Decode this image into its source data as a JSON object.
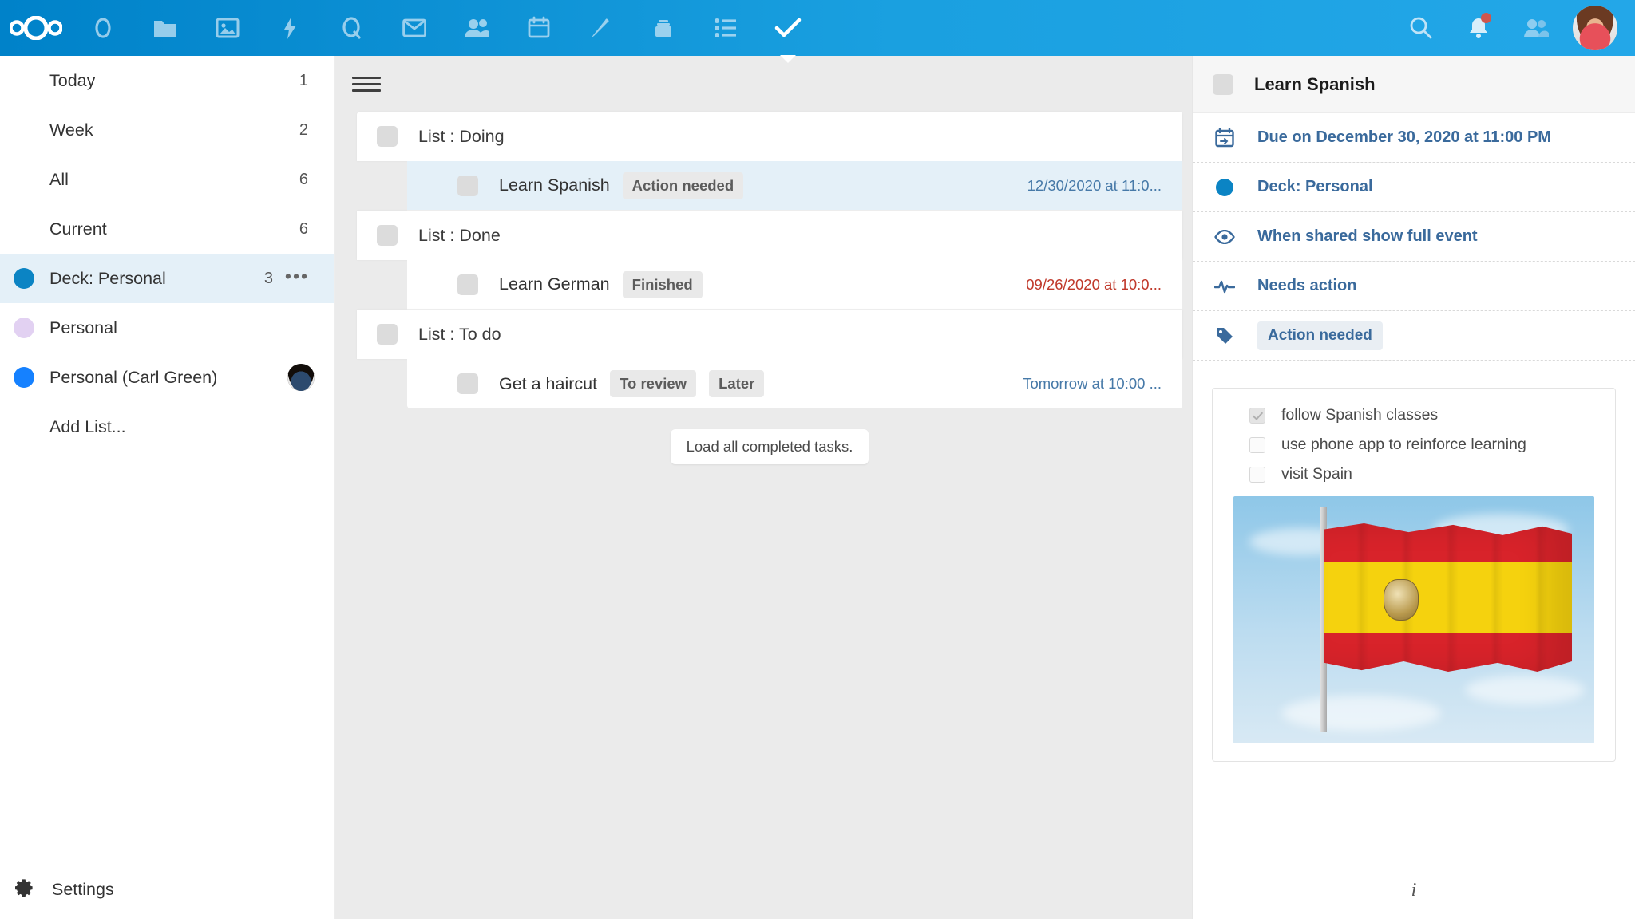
{
  "header": {
    "logo_name": "nextcloud-logo",
    "apps": [
      {
        "name": "dashboard-icon",
        "label": "Dashboard"
      },
      {
        "name": "files-icon",
        "label": "Files"
      },
      {
        "name": "photos-icon",
        "label": "Photos"
      },
      {
        "name": "activity-icon",
        "label": "Activity"
      },
      {
        "name": "search-app-icon",
        "label": "Circles"
      },
      {
        "name": "mail-icon",
        "label": "Mail"
      },
      {
        "name": "contacts-icon",
        "label": "Contacts"
      },
      {
        "name": "calendar-icon",
        "label": "Calendar"
      },
      {
        "name": "notes-icon",
        "label": "Notes"
      },
      {
        "name": "deck-icon",
        "label": "Deck"
      },
      {
        "name": "list-icon",
        "label": "Lists"
      },
      {
        "name": "tasks-icon",
        "label": "Tasks",
        "active": true
      }
    ],
    "right": {
      "search_label": "Search",
      "notifications_label": "Notifications",
      "has_notification": true,
      "contacts_label": "Contacts menu",
      "avatar_label": "User avatar"
    },
    "accent_color": "#0082c9"
  },
  "sidebar": {
    "items": [
      {
        "label": "Today",
        "count": "1",
        "dot": null,
        "selected": false
      },
      {
        "label": "Week",
        "count": "2",
        "dot": null,
        "selected": false
      },
      {
        "label": "All",
        "count": "6",
        "dot": null,
        "selected": false
      },
      {
        "label": "Current",
        "count": "6",
        "dot": null,
        "selected": false
      },
      {
        "label": "Deck: Personal",
        "count": "3",
        "dot": "#0b84c4",
        "selected": true,
        "menu": "•••"
      },
      {
        "label": "Personal",
        "count": "",
        "dot": "#e2d1f2",
        "selected": false
      },
      {
        "label": "Personal (Carl Green)",
        "count": "",
        "dot": "#1581ff",
        "selected": false,
        "shared_avatar": true
      },
      {
        "label": "Add List...",
        "count": "",
        "dot": null,
        "selected": false
      }
    ],
    "settings_label": "Settings",
    "settings_icon": "gear-icon"
  },
  "main": {
    "menu_icon": "hamburger-icon",
    "groups": [
      {
        "title": "List : Doing",
        "tasks": [
          {
            "title": "Learn Spanish",
            "tags": [
              "Action needed"
            ],
            "date": "12/30/2020 at 11:0...",
            "overdue": false,
            "selected": true
          }
        ]
      },
      {
        "title": "List : Done",
        "tasks": [
          {
            "title": "Learn German",
            "tags": [
              "Finished"
            ],
            "date": "09/26/2020 at 10:0...",
            "overdue": true,
            "selected": false
          }
        ]
      },
      {
        "title": "List : To do",
        "tasks": [
          {
            "title": "Get a haircut",
            "tags": [
              "To review",
              "Later"
            ],
            "date": "Tomorrow at 10:00 ...",
            "overdue": false,
            "selected": false
          }
        ]
      }
    ],
    "load_more_label": "Load all completed tasks."
  },
  "detail": {
    "title": "Learn Spanish",
    "rows": [
      {
        "icon": "calendar-due-icon",
        "text": "Due on December 30, 2020 at 11:00 PM",
        "type": "text"
      },
      {
        "icon": "list-color-dot",
        "text": "Deck: Personal",
        "type": "dot"
      },
      {
        "icon": "eye-icon",
        "text": "When shared show full event",
        "type": "text"
      },
      {
        "icon": "pulse-icon",
        "text": "Needs action",
        "type": "text"
      },
      {
        "icon": "tag-icon",
        "text": "Action needed",
        "type": "tag"
      }
    ],
    "checklist": [
      {
        "label": "follow Spanish classes",
        "checked": true
      },
      {
        "label": "use phone app to reinforce learning",
        "checked": false
      },
      {
        "label": "visit Spain",
        "checked": false
      }
    ],
    "image_alt": "flag-of-spain-photo",
    "footer_icon": "info-icon"
  }
}
